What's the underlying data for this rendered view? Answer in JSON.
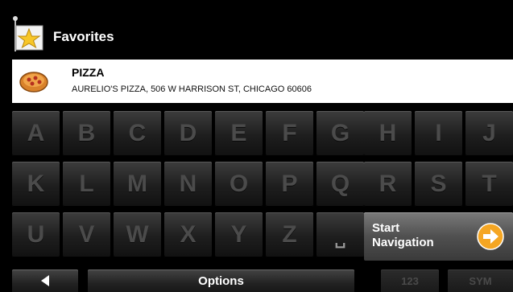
{
  "header": {
    "title": "Favorites",
    "icon": "favorites-flag-icon"
  },
  "result": {
    "icon": "pizza-icon",
    "name": "PIZZA",
    "address": "AURELIO'S PIZZA, 506 W HARRISON ST, CHICAGO 60606"
  },
  "keyboard": {
    "row1": [
      "A",
      "B",
      "C",
      "D",
      "E",
      "F",
      "G",
      "H",
      "I",
      "J"
    ],
    "row2": [
      "K",
      "L",
      "M",
      "N",
      "O",
      "P",
      "Q",
      "R",
      "S",
      "T"
    ],
    "row3": [
      "U",
      "V",
      "W",
      "X",
      "Y",
      "Z",
      "␣"
    ],
    "start_navigation_line1": "Start",
    "start_navigation_line2": "Navigation",
    "start_navigation_icon": "arrow-right-circle-icon"
  },
  "bottom_bar": {
    "back_icon": "triangle-left-icon",
    "options_label": "Options",
    "numeric_label": "123",
    "symbols_label": "SYM"
  },
  "colors": {
    "background": "#000000",
    "accent_orange": "#f5a623",
    "key_text": "#4b4b4b"
  }
}
